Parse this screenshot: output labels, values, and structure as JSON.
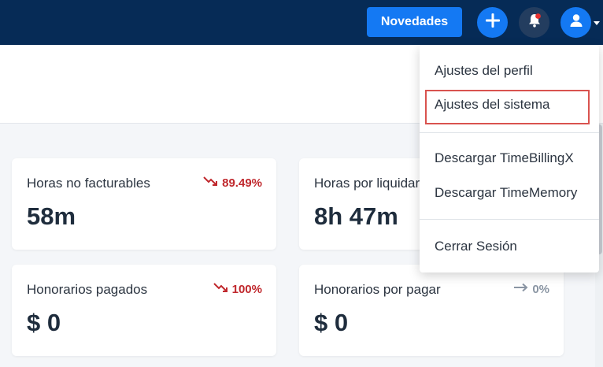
{
  "topbar": {
    "news_label": "Novedades",
    "add_icon": "plus-icon",
    "bell_icon": "bell-icon",
    "user_icon": "user-icon",
    "notification_dot_color": "#e8312f"
  },
  "cards": [
    {
      "title": "Horas no facturables",
      "value": "58m",
      "trend": "89.49%",
      "trend_dir": "down"
    },
    {
      "title": "Horas por liquidar",
      "value": "8h 47m",
      "trend": "",
      "trend_dir": ""
    },
    {
      "title": "Honorarios pagados",
      "value": "$ 0",
      "trend": "100%",
      "trend_dir": "down"
    },
    {
      "title": "Honorarios por pagar",
      "value": "$ 0",
      "trend": "0%",
      "trend_dir": "flat"
    }
  ],
  "dropdown": {
    "items": [
      "Ajustes del perfil",
      "Ajustes del sistema",
      "Descargar TimeBillingX",
      "Descargar TimeMemory",
      "Cerrar Sesión"
    ]
  },
  "colors": {
    "topbar": "#062b56",
    "accent": "#1479f3",
    "trend_down": "#c0282d",
    "trend_flat": "#8a95a3",
    "highlight": "#d9534f"
  }
}
